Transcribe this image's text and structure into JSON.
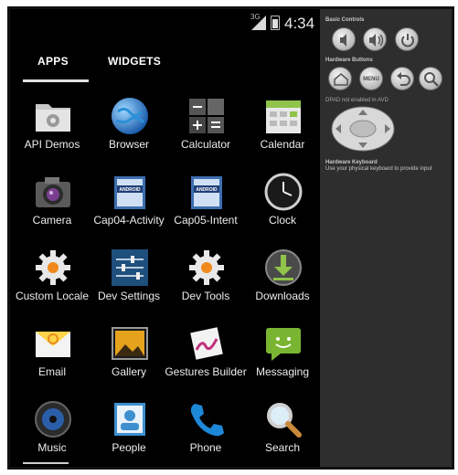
{
  "status_bar": {
    "network": "3G",
    "time": "4:34"
  },
  "tabs": [
    {
      "label": "APPS",
      "selected": true
    },
    {
      "label": "WIDGETS",
      "selected": false
    }
  ],
  "apps": [
    {
      "label": "API Demos",
      "icon": "api-demos-folder-icon"
    },
    {
      "label": "Browser",
      "icon": "globe-icon"
    },
    {
      "label": "Calculator",
      "icon": "calculator-icon"
    },
    {
      "label": "Calendar",
      "icon": "calendar-icon"
    },
    {
      "label": "Camera",
      "icon": "camera-icon"
    },
    {
      "label": "Cap04-Activity",
      "icon": "android-book-icon"
    },
    {
      "label": "Cap05-Intent",
      "icon": "android-book-icon"
    },
    {
      "label": "Clock",
      "icon": "clock-icon"
    },
    {
      "label": "Custom Locale",
      "icon": "gear-icon"
    },
    {
      "label": "Dev Settings",
      "icon": "sliders-icon"
    },
    {
      "label": "Dev Tools",
      "icon": "gear-icon"
    },
    {
      "label": "Downloads",
      "icon": "download-icon"
    },
    {
      "label": "Email",
      "icon": "email-icon"
    },
    {
      "label": "Gallery",
      "icon": "gallery-icon"
    },
    {
      "label": "Gestures Builder",
      "icon": "gestures-icon"
    },
    {
      "label": "Messaging",
      "icon": "messaging-icon"
    },
    {
      "label": "Music",
      "icon": "speaker-icon"
    },
    {
      "label": "People",
      "icon": "contacts-icon"
    },
    {
      "label": "Phone",
      "icon": "phone-icon"
    },
    {
      "label": "Search",
      "icon": "magnifier-icon"
    }
  ],
  "panel": {
    "basic_controls": "Basic Controls",
    "hardware_buttons": "Hardware Buttons",
    "menu_label": "MENU",
    "dpad_note": "DPAD not enabled in AVD",
    "keyboard_title": "Hardware Keyboard",
    "keyboard_note": "Use your physical keyboard to provide input"
  }
}
